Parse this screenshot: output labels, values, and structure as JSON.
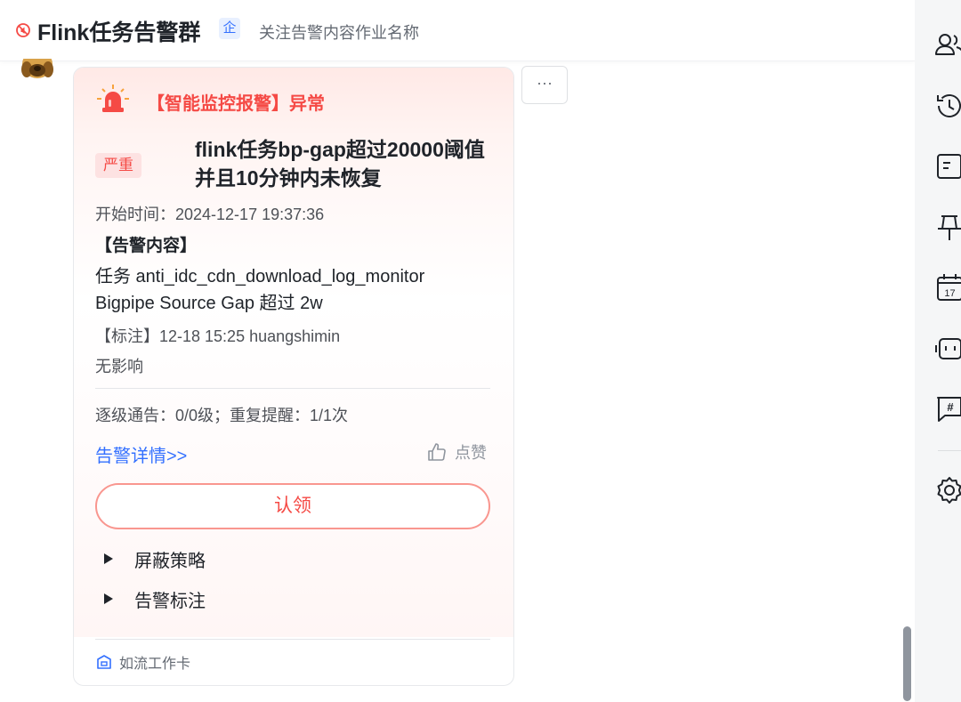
{
  "header": {
    "group_name": "Flink任务告警群",
    "enterprise_badge": "企",
    "description": "关注告警内容作业名称"
  },
  "card": {
    "title": "【智能监控报警】异常",
    "severity": "严重",
    "headline": "flink任务bp-gap超过20000阈值并且10分钟内未恢复",
    "start_time": "开始时间：2024-12-17 19:37:36",
    "content_heading": "【告警内容】",
    "content_line1": "任务 anti_idc_cdn_download_log_monitor",
    "content_line2": "Bigpipe Source Gap 超过 2w",
    "annotation": "【标注】12-18 15:25 huangshimin",
    "impact": "无影响",
    "escalation": "逐级通告：0/0级；重复提醒：1/1次",
    "detail_link": "告警详情>>",
    "like_label": "点赞",
    "claim_button": "认领",
    "expand_items": [
      {
        "label": "屏蔽策略"
      },
      {
        "label": "告警标注"
      }
    ],
    "footer": "如流工作卡"
  },
  "more_button": "···",
  "colors": {
    "alert_red": "#f54a45",
    "link_blue": "#3370ff",
    "badge_bg": "#fde2e2",
    "sidebar_bg": "#f5f6f7"
  },
  "sidebar_icons": [
    "members-icon",
    "history-icon",
    "docs-icon",
    "pin-icon",
    "calendar-icon",
    "robot-icon",
    "topic-icon",
    "settings-icon"
  ],
  "calendar_day": "17"
}
